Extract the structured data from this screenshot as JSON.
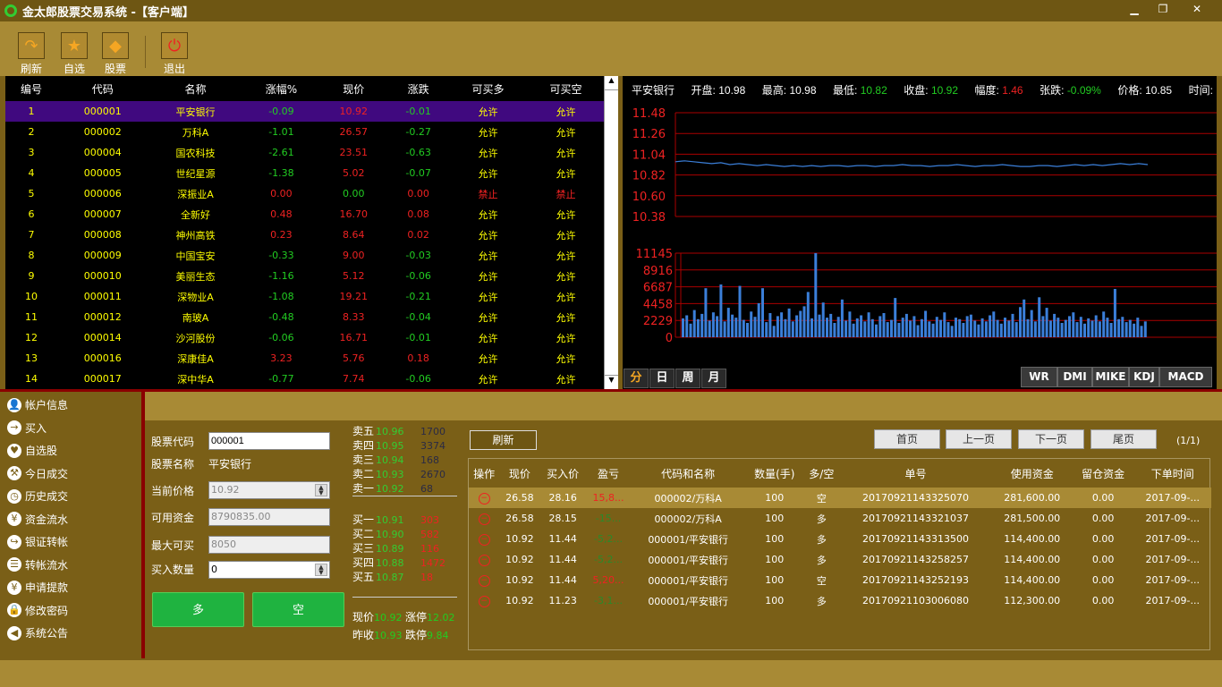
{
  "window": {
    "title": "金太郎股票交易系统 -【客户端】",
    "minimize": "▁",
    "restore": "❐",
    "close": "✕"
  },
  "toolbar": [
    {
      "label": "刷新",
      "icon": "refresh-icon",
      "glyph": "↷"
    },
    {
      "label": "自选",
      "icon": "star-icon",
      "glyph": "★"
    },
    {
      "label": "股票",
      "icon": "diamond-icon",
      "glyph": "◆"
    },
    {
      "label": "退出",
      "icon": "power-icon",
      "glyph": "⏻"
    }
  ],
  "stock_table": {
    "headers": [
      "编号",
      "代码",
      "名称",
      "涨幅%",
      "现价",
      "涨跌",
      "可买多",
      "可买空"
    ],
    "rows": [
      [
        "1",
        "000001",
        "平安银行",
        "-0.09",
        "10.92",
        "-0.01",
        "允许",
        "允许"
      ],
      [
        "2",
        "000002",
        "万科A",
        "-1.01",
        "26.57",
        "-0.27",
        "允许",
        "允许"
      ],
      [
        "3",
        "000004",
        "国农科技",
        "-2.61",
        "23.51",
        "-0.63",
        "允许",
        "允许"
      ],
      [
        "4",
        "000005",
        "世纪星源",
        "-1.38",
        "5.02",
        "-0.07",
        "允许",
        "允许"
      ],
      [
        "5",
        "000006",
        "深振业A",
        "0.00",
        "0.00",
        "0.00",
        "禁止",
        "禁止"
      ],
      [
        "6",
        "000007",
        "全新好",
        "0.48",
        "16.70",
        "0.08",
        "允许",
        "允许"
      ],
      [
        "7",
        "000008",
        "神州高铁",
        "0.23",
        "8.64",
        "0.02",
        "允许",
        "允许"
      ],
      [
        "8",
        "000009",
        "中国宝安",
        "-0.33",
        "9.00",
        "-0.03",
        "允许",
        "允许"
      ],
      [
        "9",
        "000010",
        "美丽生态",
        "-1.16",
        "5.12",
        "-0.06",
        "允许",
        "允许"
      ],
      [
        "10",
        "000011",
        "深物业A",
        "-1.08",
        "19.21",
        "-0.21",
        "允许",
        "允许"
      ],
      [
        "11",
        "000012",
        "南玻A",
        "-0.48",
        "8.33",
        "-0.04",
        "允许",
        "允许"
      ],
      [
        "12",
        "000014",
        "沙河股份",
        "-0.06",
        "16.71",
        "-0.01",
        "允许",
        "允许"
      ],
      [
        "13",
        "000016",
        "深康佳A",
        "3.23",
        "5.76",
        "0.18",
        "允许",
        "允许"
      ],
      [
        "14",
        "000017",
        "深中华A",
        "-0.77",
        "7.74",
        "-0.06",
        "允许",
        "允许"
      ]
    ]
  },
  "quote_header": {
    "name": "平安银行",
    "open_l": "开盘:",
    "open": "10.98",
    "high_l": "最高:",
    "high": "10.98",
    "low_l": "最低:",
    "low": "10.82",
    "close_l": "收盘:",
    "close": "10.92",
    "amp_l": "幅度:",
    "amp": "1.46",
    "chg_l": "张跌:",
    "chg": "-0.09%",
    "price_l": "价格:",
    "price": "10.85",
    "time_l": "时间:"
  },
  "chart_data": [
    {
      "type": "line",
      "yticks": [
        "11.48",
        "11.26",
        "11.04",
        "10.82",
        "10.60",
        "10.38"
      ],
      "ylim": [
        10.38,
        11.48
      ],
      "grid": true,
      "color": "#3b7fd9",
      "values": [
        10.96,
        10.97,
        10.96,
        10.95,
        10.94,
        10.95,
        10.93,
        10.94,
        10.93,
        10.92,
        10.93,
        10.92,
        10.91,
        10.92,
        10.91,
        10.92,
        10.91,
        10.92,
        10.92,
        10.91,
        10.92,
        10.92,
        10.91,
        10.92,
        10.92,
        10.93,
        10.92,
        10.92,
        10.91,
        10.92,
        10.92,
        10.93,
        10.92,
        10.91,
        10.92,
        10.92,
        10.93,
        10.92,
        10.91,
        10.91,
        10.92,
        10.92,
        10.91,
        10.92,
        10.93,
        10.92,
        10.93,
        10.92,
        10.93,
        10.94,
        10.93,
        10.94,
        10.93
      ]
    },
    {
      "type": "bar",
      "yticks": [
        "11145",
        "8916",
        "6687",
        "4458",
        "2229",
        "0"
      ],
      "ylim": [
        0,
        11145
      ],
      "grid": true,
      "color": "#3b7fd9",
      "values": [
        2500,
        2900,
        1800,
        3600,
        2400,
        3100,
        6500,
        2200,
        3300,
        2800,
        7000,
        2100,
        3900,
        3000,
        2600,
        6800,
        2300,
        1900,
        3400,
        2700,
        4500,
        6500,
        2000,
        3200,
        1500,
        2800,
        3300,
        2400,
        3800,
        2100,
        2900,
        3500,
        4100,
        6000,
        2500,
        11145,
        3000,
        4600,
        2600,
        3100,
        1900,
        2700,
        5000,
        2200,
        3400,
        1800,
        2500,
        2900,
        2100,
        3300,
        2400,
        1700,
        2800,
        3200,
        2000,
        2300,
        5200,
        1900,
        2600,
        3100,
        2200,
        2800,
        1600,
        2400,
        3500,
        2100,
        1800,
        2700,
        2300,
        3300,
        2000,
        1500,
        2600,
        2400,
        1900,
        2800,
        3000,
        2200,
        1700,
        2500,
        2100,
        2900,
        3400,
        2300,
        1800,
        2600,
        2200,
        3100,
        2000,
        4000,
        5000,
        2400,
        3600,
        2100,
        5300,
        2800,
        3900,
        2200,
        3100,
        2600,
        1900,
        2300,
        2800,
        3300,
        2000,
        2700,
        1800,
        2500,
        2200,
        2900,
        2100,
        3400,
        2600,
        1900,
        6400,
        2400,
        2700,
        2000,
        2300,
        1800,
        2600,
        1500,
        2100
      ]
    }
  ],
  "period_tabs": [
    "分",
    "日",
    "周",
    "月"
  ],
  "indicator_tabs": [
    "WR",
    "DMI",
    "MIKE",
    "KDJ",
    "MACD"
  ],
  "sidebar": [
    {
      "label": "帐户信息",
      "glyph": "👤",
      "icon": "user-icon"
    },
    {
      "label": "买入",
      "glyph": "→",
      "icon": "arrow-right-icon"
    },
    {
      "label": "自选股",
      "glyph": "♥",
      "icon": "heart-icon"
    },
    {
      "label": "今日成交",
      "glyph": "⚒",
      "icon": "hammer-icon"
    },
    {
      "label": "历史成交",
      "glyph": "◷",
      "icon": "clock-icon"
    },
    {
      "label": "资金流水",
      "glyph": "¥",
      "icon": "money-bag-icon"
    },
    {
      "label": "银证转帐",
      "glyph": "↪",
      "icon": "transfer-icon"
    },
    {
      "label": "转帐流水",
      "glyph": "☰",
      "icon": "list-icon"
    },
    {
      "label": "申请提款",
      "glyph": "¥",
      "icon": "yen-icon"
    },
    {
      "label": "修改密码",
      "glyph": "🔒",
      "icon": "lock-icon"
    },
    {
      "label": "系统公告",
      "glyph": "◀",
      "icon": "speaker-icon"
    }
  ],
  "form": {
    "code_l": "股票代码",
    "code": "000001",
    "name_l": "股票名称",
    "name": "平安银行",
    "price_l": "当前价格",
    "price": "10.92",
    "funds_l": "可用资金",
    "funds": "8790835.00",
    "max_l": "最大可买",
    "max": "8050",
    "qty_l": "买入数量",
    "qty": "0",
    "long_btn": "多",
    "short_btn": "空"
  },
  "orderbook": {
    "sell": [
      [
        "卖五",
        "10.96",
        "1700"
      ],
      [
        "卖四",
        "10.95",
        "3374"
      ],
      [
        "卖三",
        "10.94",
        "168"
      ],
      [
        "卖二",
        "10.93",
        "2670"
      ],
      [
        "卖一",
        "10.92",
        "68"
      ]
    ],
    "buy": [
      [
        "买一",
        "10.91",
        "303"
      ],
      [
        "买二",
        "10.90",
        "582"
      ],
      [
        "买三",
        "10.89",
        "116"
      ],
      [
        "买四",
        "10.88",
        "1472"
      ],
      [
        "买五",
        "10.87",
        "18"
      ]
    ],
    "now_l": "现价",
    "now": "10.92",
    "up_l": "涨停",
    "up": "12.02",
    "prev_l": "昨收",
    "prev": "10.93",
    "down_l": "跌停",
    "down": "9.84"
  },
  "orders": {
    "refresh": "刷新",
    "first": "首页",
    "prev": "上一页",
    "next": "下一页",
    "last": "尾页",
    "page": "(1/1)",
    "headers": [
      "操作",
      "现价",
      "买入价",
      "盈亏",
      "代码和名称",
      "数量(手)",
      "多/空",
      "单号",
      "使用资金",
      "留仓资金",
      "下单时间"
    ],
    "rows": [
      [
        "26.58",
        "28.16",
        "15,8...",
        "000002/万科A",
        "100",
        "空",
        "20170921143325070",
        "281,600.00",
        "0.00",
        "2017-09-..."
      ],
      [
        "26.58",
        "28.15",
        "-15...",
        "000002/万科A",
        "100",
        "多",
        "20170921143321037",
        "281,500.00",
        "0.00",
        "2017-09-..."
      ],
      [
        "10.92",
        "11.44",
        "-5,2...",
        "000001/平安银行",
        "100",
        "多",
        "20170921143313500",
        "114,400.00",
        "0.00",
        "2017-09-..."
      ],
      [
        "10.92",
        "11.44",
        "-5,2...",
        "000001/平安银行",
        "100",
        "多",
        "20170921143258257",
        "114,400.00",
        "0.00",
        "2017-09-..."
      ],
      [
        "10.92",
        "11.44",
        "5,20...",
        "000001/平安银行",
        "100",
        "空",
        "20170921143252193",
        "114,400.00",
        "0.00",
        "2017-09-..."
      ],
      [
        "10.92",
        "11.23",
        "-3,1...",
        "000001/平安银行",
        "100",
        "多",
        "20170921103006080",
        "112,300.00",
        "0.00",
        "2017-09-..."
      ]
    ]
  }
}
